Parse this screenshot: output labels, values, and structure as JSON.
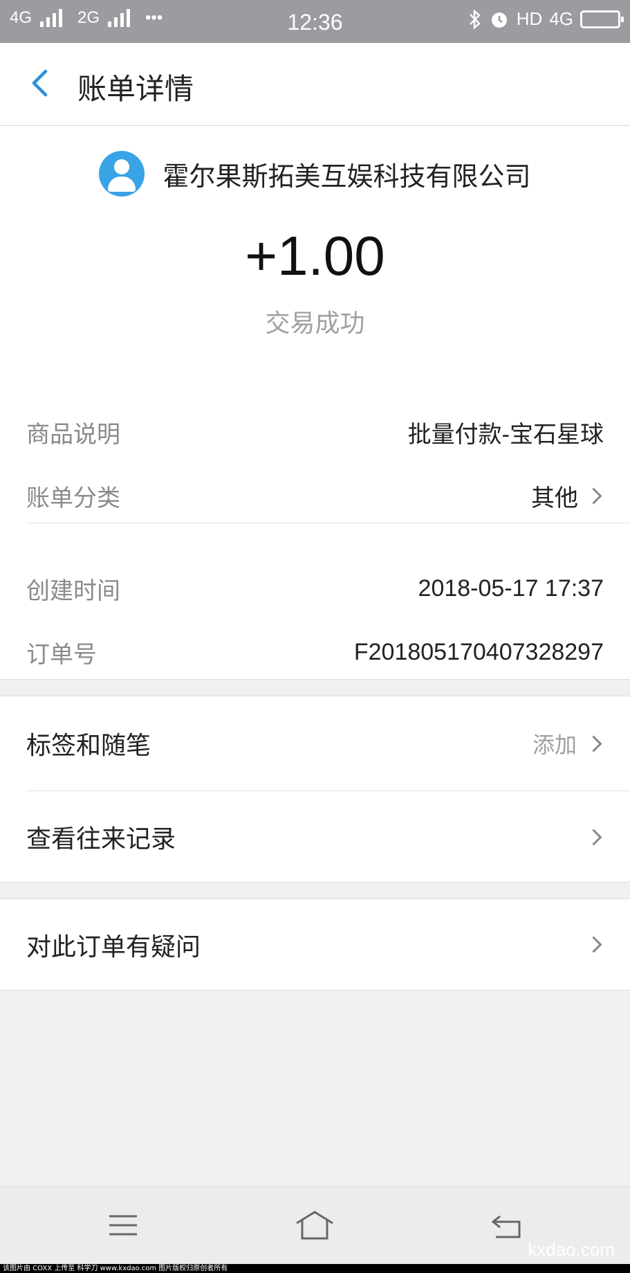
{
  "status_bar": {
    "net1": "4G",
    "net2": "2G",
    "more": "•••",
    "time": "12:36",
    "hd": "HD",
    "net3": "4G"
  },
  "header": {
    "title": "账单详情"
  },
  "transaction": {
    "merchant": "霍尔果斯拓美互娱科技有限公司",
    "amount": "+1.00",
    "status": "交易成功"
  },
  "details": [
    {
      "label": "商品说明",
      "value": "批量付款-宝石星球"
    },
    {
      "label": "账单分类",
      "value": "其他"
    },
    {
      "label": "创建时间",
      "value": "2018-05-17 17:37"
    },
    {
      "label": "订单号",
      "value": "F201805170407328297"
    }
  ],
  "actions": {
    "tags": {
      "label": "标签和随笔",
      "value": "添加"
    },
    "history": {
      "label": "查看往来记录"
    },
    "question": {
      "label": "对此订单有疑问"
    }
  },
  "watermark": {
    "caption": "该图片由 COXX 上传至 科学刀 www.kxdao.com 图片版权归原创者所有",
    "site": "kxdao.com"
  },
  "colors": {
    "accent": "#3aa3e6",
    "status_bar": "#9b9ba0"
  }
}
